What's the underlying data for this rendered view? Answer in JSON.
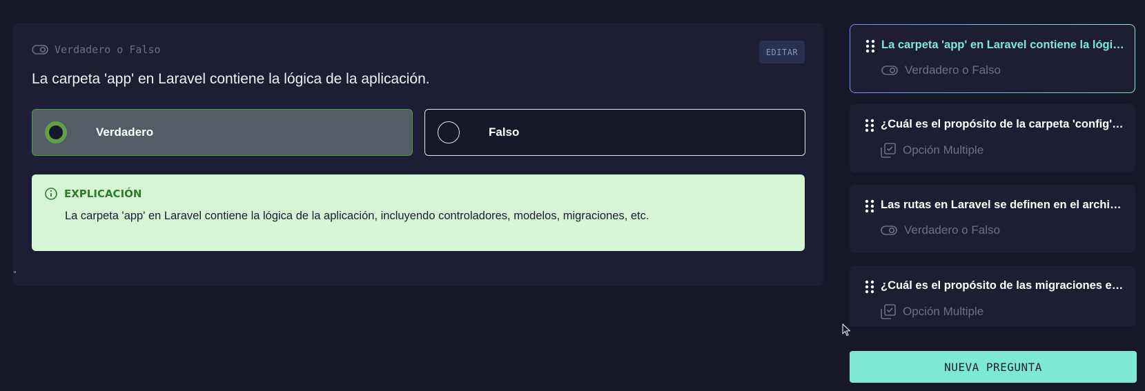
{
  "question": {
    "type_label": "Verdadero o Falso",
    "edit_label": "EDITAR",
    "text": "La carpeta 'app' en Laravel contiene la lógica de la aplicación.",
    "options": [
      {
        "label": "Verdadero",
        "selected": true
      },
      {
        "label": "Falso",
        "selected": false
      }
    ],
    "explanation": {
      "heading": "EXPLICACIÓN",
      "body": "La carpeta 'app' en Laravel contiene la lógica de la aplicación, incluyendo controladores, modelos, migraciones, etc."
    },
    "stray_mark": "\""
  },
  "sidebar": {
    "items": [
      {
        "title": "La carpeta 'app' en Laravel contiene la lógica de la aplicación.",
        "type": "Verdadero o Falso",
        "type_icon": "toggle-icon",
        "active": true
      },
      {
        "title": "¿Cuál es el propósito de la carpeta 'config' en Laravel?",
        "type": "Opción Multiple",
        "type_icon": "multiple-choice-icon",
        "active": false
      },
      {
        "title": "Las rutas en Laravel se definen en el archivo routes/web.php.",
        "type": "Verdadero o Falso",
        "type_icon": "toggle-icon",
        "active": false
      },
      {
        "title": "¿Cuál es el propósito de las migraciones en Laravel?",
        "type": "Opción Multiple",
        "type_icon": "multiple-choice-icon",
        "active": false
      }
    ],
    "new_button_label": "NUEVA PREGUNTA"
  },
  "colors": {
    "background": "#17172a",
    "card": "#1d1d33",
    "accent": "#7ee8d6",
    "selected_green": "#5fa048",
    "explanation_bg": "#d6f5d5"
  }
}
